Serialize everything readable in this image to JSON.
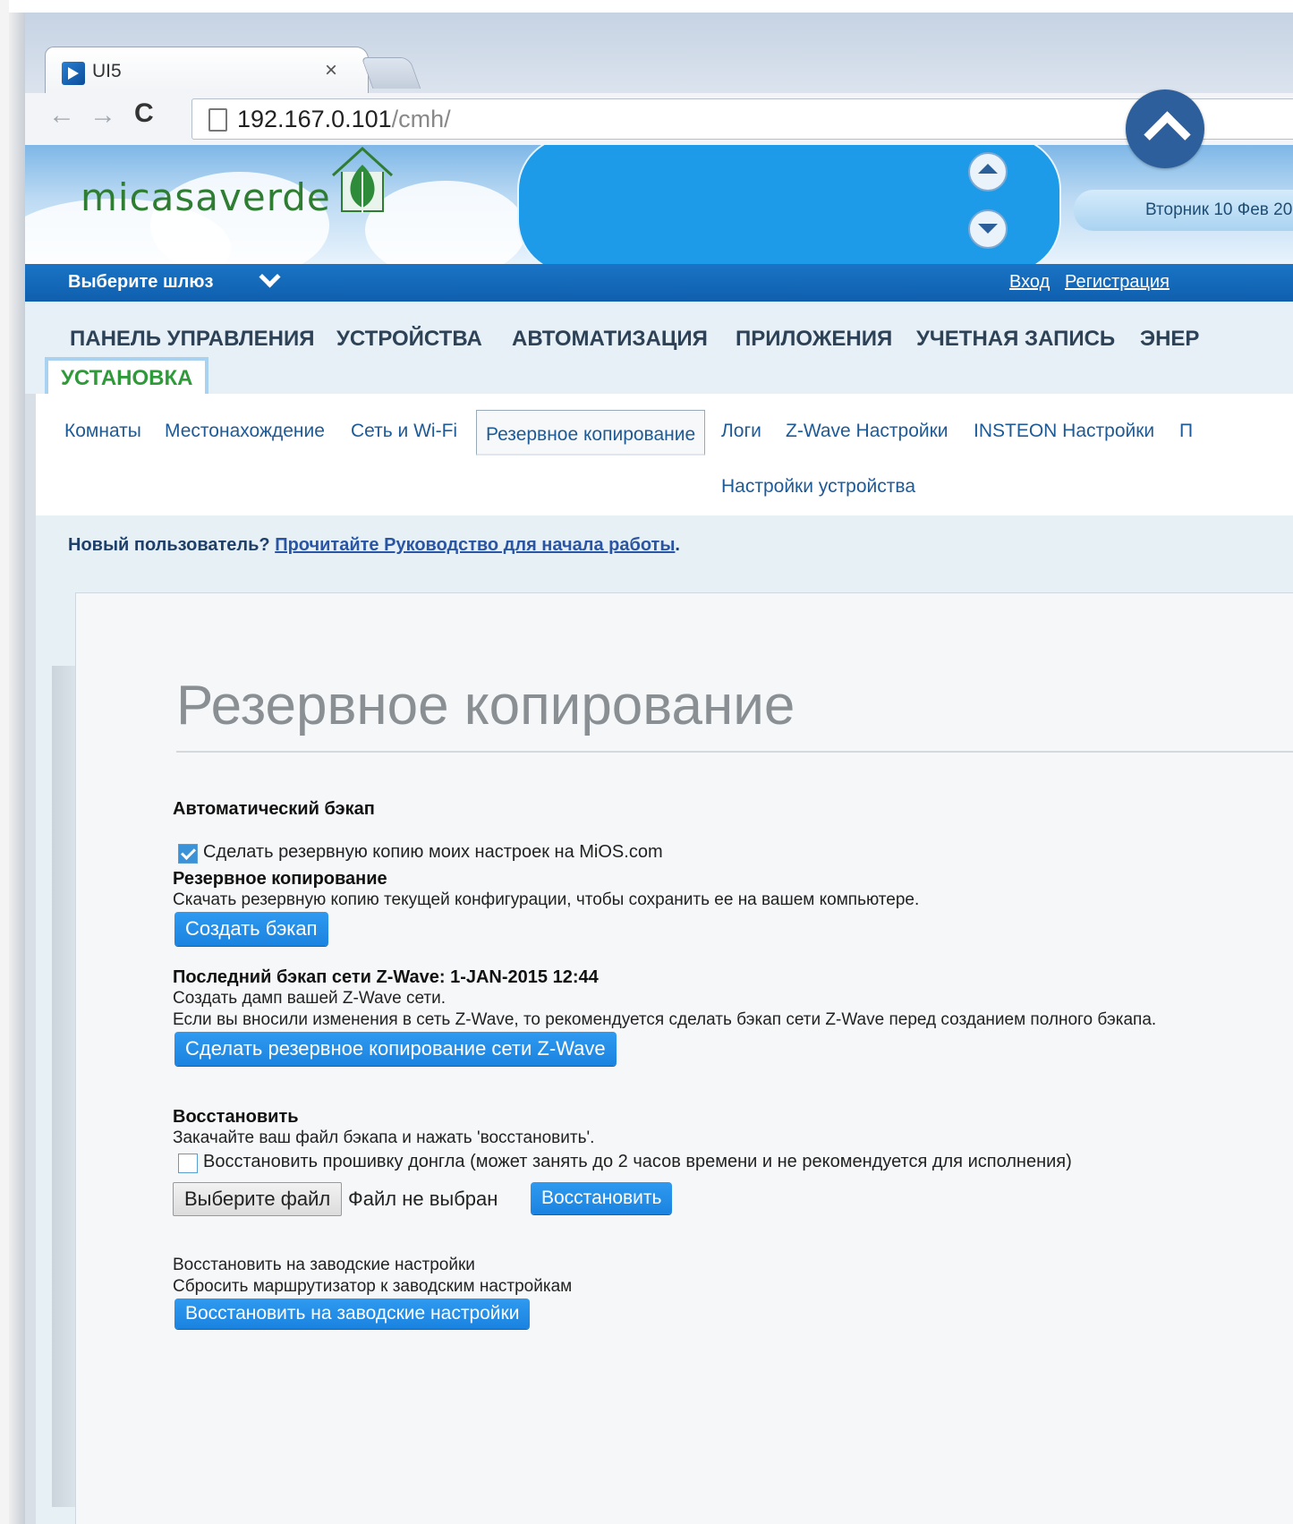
{
  "browser": {
    "tab_title": "UI5",
    "tab_close": "×",
    "url_host": "192.167.0.101",
    "url_path": "/cmh/",
    "back": "←",
    "forward": "→",
    "reload": "C"
  },
  "header": {
    "logo": "micasaverde",
    "date": "Вторник 10 Фев 20",
    "gateway_label": "Выберите шлюз",
    "login": "Вход",
    "register": "Регистрация"
  },
  "main_nav": {
    "items": [
      "ПАНЕЛЬ УПРАВЛЕНИЯ",
      "УСТРОЙСТВА",
      "АВТОМАТИЗАЦИЯ",
      "ПРИЛОЖЕНИЯ",
      "УЧЕТНАЯ ЗАПИСЬ",
      "ЭНЕР"
    ],
    "active": "УСТАНОВКА"
  },
  "sub_nav": {
    "items": [
      "Комнаты",
      "Местонахождение",
      "Сеть и Wi-Fi",
      "Резервное копирование",
      "Логи",
      "Z-Wave Настройки",
      "INSTEON Настройки",
      "П",
      "Настройки устройства"
    ]
  },
  "guide": {
    "prefix": "Новый пользователь? ",
    "link": "Прочитайте Руководство для начала работы",
    "suffix": "."
  },
  "page": {
    "title": "Резервное копирование",
    "auto_backup": {
      "heading": "Автоматический бэкап",
      "checkbox_label": "Сделать резервную копию моих настроек на MiOS.com",
      "checked": true
    },
    "backup": {
      "heading": "Резервное копирование",
      "description": "Скачать резервную копию текущей конфигурации, чтобы сохранить ее на вашем компьютере.",
      "button": "Создать бэкап"
    },
    "zwave": {
      "heading": "Последний бэкап сети Z-Wave: 1-JAN-2015 12:44",
      "line1": "Создать дамп вашей Z-Wave сети.",
      "line2": "Если вы вносили изменения в сеть Z-Wave, то рекомендуется сделать бэкап сети Z-Wave перед созданием полного бэкапа.",
      "button": "Сделать резервное копирование сети Z-Wave"
    },
    "restore": {
      "heading": "Восстановить",
      "description": "Закачайте ваш файл бэкапа и нажать 'восстановить'.",
      "checkbox_label": "Восстановить прошивку донгла (может занять до 2 часов времени и не рекомендуется для исполнения)",
      "checked": false,
      "file_button": "Выберите файл",
      "file_status": "Файл не выбран",
      "button": "Восстановить"
    },
    "factory": {
      "heading": "Восстановить на заводские настройки",
      "description": "Сбросить маршрутизатор к заводским настройкам",
      "button": "Восстановить на заводские настройки"
    }
  },
  "colors": {
    "accent": "#1a83e0",
    "header_bar": "#1267b8",
    "active_nav": "#2f9a3a",
    "scroll_button": "#2c5f9c"
  }
}
